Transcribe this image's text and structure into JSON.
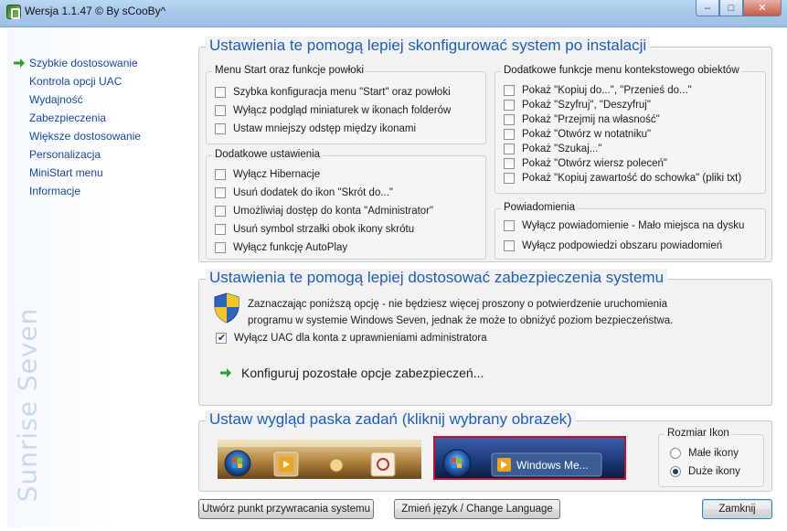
{
  "window": {
    "title": "Wersja 1.1.47 © By sCooBy^",
    "controls": {
      "minimize": "‒",
      "maximize": "□",
      "close": "✕"
    }
  },
  "sidebar": {
    "items": [
      {
        "label": "Szybkie dostosowanie",
        "active": true
      },
      {
        "label": "Kontrola opcji UAC",
        "active": false
      },
      {
        "label": "Wydajność",
        "active": false
      },
      {
        "label": "Zabezpieczenia",
        "active": false
      },
      {
        "label": "Większe dostosowanie",
        "active": false
      },
      {
        "label": "Personalizacja",
        "active": false
      },
      {
        "label": "MiniStart menu",
        "active": false
      },
      {
        "label": "Informacje",
        "active": false
      }
    ],
    "watermark": "Sunrise Seven"
  },
  "section1": {
    "title": "Ustawienia te pomogą lepiej skonfigurować system po instalacji",
    "menu_start": {
      "title": "Menu Start oraz funkcje powłoki",
      "options": [
        {
          "label": "Szybka konfiguracja menu \"Start\" oraz powłoki",
          "checked": false
        },
        {
          "label": "Wyłącz podgląd miniaturek w ikonach folderów",
          "checked": false
        },
        {
          "label": "Ustaw mniejszy odstęp między ikonami",
          "checked": false
        }
      ]
    },
    "additional": {
      "title": "Dodatkowe ustawienia",
      "options": [
        {
          "label": "Wyłącz Hibernacje",
          "checked": false
        },
        {
          "label": "Usuń dodatek do ikon \"Skrót do...\"",
          "checked": false
        },
        {
          "label": "Umożliwiaj dostęp do konta \"Administrator\"",
          "checked": false
        },
        {
          "label": "Usuń symbol strzałki obok ikony skrótu",
          "checked": false
        },
        {
          "label": "Wyłącz funkcję AutoPlay",
          "checked": false
        }
      ]
    },
    "context_menu": {
      "title": "Dodatkowe funkcje menu kontekstowego obiektów",
      "options": [
        {
          "label": "Pokaż \"Kopiuj do...\", \"Przenieś do...\"",
          "checked": false
        },
        {
          "label": "Pokaż \"Szyfruj\", \"Deszyfruj\"",
          "checked": false
        },
        {
          "label": "Pokaż \"Przejmij na własność\"",
          "checked": false
        },
        {
          "label": "Pokaż \"Otwórz w notatniku\"",
          "checked": false
        },
        {
          "label": "Pokaż \"Szukaj...\"",
          "checked": false
        },
        {
          "label": "Pokaż \"Otwórz wiersz poleceń\"",
          "checked": false
        },
        {
          "label": "Pokaż \"Kopiuj zawartość do schowka\" (pliki txt)",
          "checked": false
        }
      ]
    },
    "notifications": {
      "title": "Powiadomienia",
      "options": [
        {
          "label": "Wyłącz powiadomienie - Mało miejsca na dysku",
          "checked": false
        },
        {
          "label": "Wyłącz podpowiedzi obszaru powiadomień",
          "checked": false
        }
      ]
    }
  },
  "section2": {
    "title": "Ustawienia te pomogą lepiej dostosować zabezpieczenia systemu",
    "description_line1": "Zaznaczając poniższą opcję - nie będziesz więcej proszony o potwierdzenie uruchomienia",
    "description_line2": "programu w systemie Windows Seven, jednak że może to obniżyć poziom bezpieczeństwa.",
    "uac_option": {
      "label": "Wyłącz UAC dla konta z uprawnieniami administratora",
      "checked": true
    },
    "configure_link": "Konfiguruj pozostałe opcje zabezpieczeń..."
  },
  "section3": {
    "title": "Ustaw wygląd paska zadań (kliknij wybrany obrazek)",
    "preview_large_label": "Windows Me...",
    "icon_size": {
      "title": "Rozmiar Ikon",
      "options": [
        {
          "label": "Małe ikony",
          "checked": false
        },
        {
          "label": "Duże ikony",
          "checked": true
        }
      ]
    }
  },
  "footer": {
    "restore_point": "Utwórz punkt przywracania systemu",
    "language": "Zmień język / Change Language",
    "close": "Zamknij"
  },
  "colors": {
    "accent": "#1c5ec2",
    "nav_link": "#1a48a8",
    "selected_border": "#c8102e",
    "arrow_green": "#2e9e2e"
  }
}
